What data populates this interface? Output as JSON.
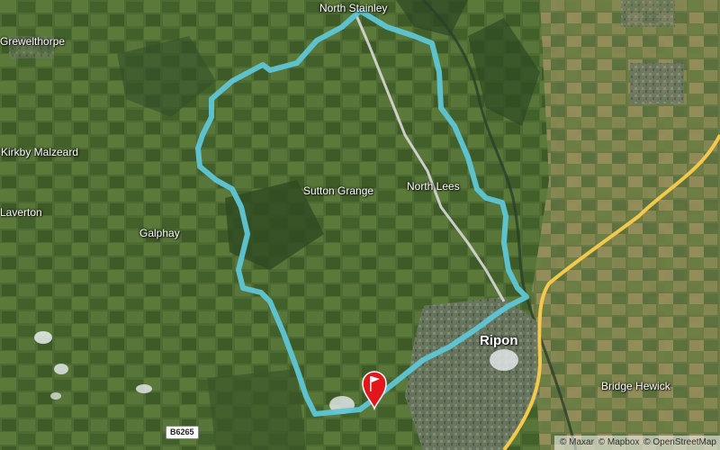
{
  "map": {
    "places": [
      {
        "name": "North Stainley",
        "kind": "small"
      },
      {
        "name": "Grewelthorpe",
        "kind": "small"
      },
      {
        "name": "Kirkby Malzeard",
        "kind": "small"
      },
      {
        "name": "Laverton",
        "kind": "small"
      },
      {
        "name": "Galphay",
        "kind": "small"
      },
      {
        "name": "Sutton Grange",
        "kind": "small"
      },
      {
        "name": "North Lees",
        "kind": "small"
      },
      {
        "name": "Ripon",
        "kind": "town"
      },
      {
        "name": "Bridge Hewick",
        "kind": "small"
      }
    ],
    "road_shield": "B6265",
    "attribution": {
      "items": [
        "© Maxar",
        "© Mapbox",
        "© OpenStreetMap"
      ]
    },
    "route_color": "#5fc6d6",
    "major_road_color": "#f2c94c",
    "minor_road_color": "#d9d9d9",
    "marker_color": "#e3171b",
    "marker_icon": "flag-icon"
  }
}
